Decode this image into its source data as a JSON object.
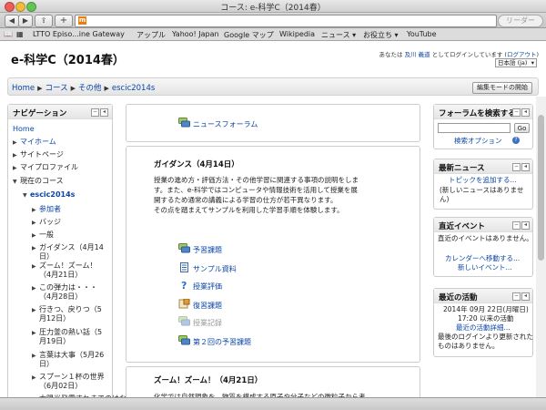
{
  "window": {
    "title": "コース: e-科学C（2014春）"
  },
  "toolbar": {
    "reader_label": "リーダー",
    "favicon_letter": "m"
  },
  "bookmarks": [
    "LTTO Episo...ine Gateway",
    "アップル",
    "Yahoo! Japan",
    "Google マップ",
    "Wikipedia",
    "ニュース ▾",
    "お役立ち ▾",
    "YouTube"
  ],
  "site": {
    "title": "e-科学C（2014春）"
  },
  "login": {
    "prefix": "あなたは",
    "user": "及川 義道",
    "middle": " としてログインしています (",
    "logout": "ログアウト",
    "suffix": ")",
    "language": "日本語 (ja)"
  },
  "breadcrumb": [
    "Home",
    "コース",
    "その他",
    "escic2014s"
  ],
  "edit_button": "編集モードの開始",
  "navigation": {
    "title": "ナビゲーション",
    "items": [
      {
        "label": "Home",
        "level": 0,
        "tri": ""
      },
      {
        "label": "マイホーム",
        "level": 0,
        "tri": "▶"
      },
      {
        "label": "サイトページ",
        "level": 0,
        "tri": "▶"
      },
      {
        "label": "マイプロファイル",
        "level": 0,
        "tri": "▶"
      },
      {
        "label": "現在のコース",
        "level": 0,
        "tri": "▼"
      },
      {
        "label": "escic2014s",
        "level": 1,
        "tri": "▼"
      },
      {
        "label": "参加者",
        "level": 2,
        "tri": "▶"
      },
      {
        "label": "バッジ",
        "level": 2,
        "tri": "▶"
      },
      {
        "label": "一般",
        "level": 2,
        "tri": "▶"
      },
      {
        "label": "ガイダンス（4月14日）",
        "level": 2,
        "tri": "▶"
      },
      {
        "label": "ズーム！ズーム！（4月21日）",
        "level": 2,
        "tri": "▶"
      },
      {
        "label": "この弾力は・・・（4月28日）",
        "level": 2,
        "tri": "▶"
      },
      {
        "label": "行きつ、戻りつ（5月12日）",
        "level": 2,
        "tri": "▶"
      },
      {
        "label": "圧力釜の熱い話（5月19日）",
        "level": 2,
        "tri": "▶"
      },
      {
        "label": "言葉は大事（5月26日）",
        "level": 2,
        "tri": "▶"
      },
      {
        "label": "スプーン１杯の世界（6月02日）",
        "level": 2,
        "tri": "▶"
      },
      {
        "label": "太陽光発電すれまでのはな",
        "level": 2,
        "tri": "▶"
      }
    ]
  },
  "main": {
    "forum": "ニュースフォーラム",
    "section1": {
      "title": "ガイダンス（4月14日）",
      "summary": [
        "授業の進め方・評価方法・その他学習に関連する事項の説明をしま",
        "す。また、e-科学ではコンピュータや情報技術を活用して授業を展",
        "開するため通常の講義による学習の仕方が若干異なります。",
        "その点を踏まえてサンプルを利用した学習手順を体験します。"
      ],
      "activities": [
        {
          "label": "予習課題",
          "icon": "forum-icon",
          "dim": false
        },
        {
          "label": "サンプル資料",
          "icon": "page-icon",
          "dim": false
        },
        {
          "label": "授業評価",
          "icon": "question-icon",
          "dim": false
        },
        {
          "label": "復習課題",
          "icon": "assignment-icon",
          "dim": false
        },
        {
          "label": "授業記録",
          "icon": "forum-icon",
          "dim": true
        },
        {
          "label": "第２回の予習課題",
          "icon": "forum-icon",
          "dim": false
        }
      ]
    },
    "section2": {
      "title": "ズーム！ズーム！（4月21日）",
      "summary": "化学では自然現象を、物質を構成する原子や分子などの微粒子から考"
    }
  },
  "search_block": {
    "title": "フォーラムを検索する",
    "go": "Go",
    "options": "検索オプション"
  },
  "news_block": {
    "title": "最新ニュース",
    "add": "トピックを追加する...",
    "empty": [
      "(新しいニュースはありませ",
      "ん)"
    ]
  },
  "events_block": {
    "title": "直近イベント",
    "empty": "直近のイベントはありません。",
    "calendar": "カレンダーへ移動する...",
    "new_event": "新しいイベント..."
  },
  "activity_block": {
    "title": "最近の活動",
    "since": [
      "2014年 09月 22日(月曜日)",
      "17:20 以来の活動"
    ],
    "full_report": "最近の活動詳細...",
    "empty": [
      "最後のログインより更新された",
      "ものはありません。"
    ]
  }
}
